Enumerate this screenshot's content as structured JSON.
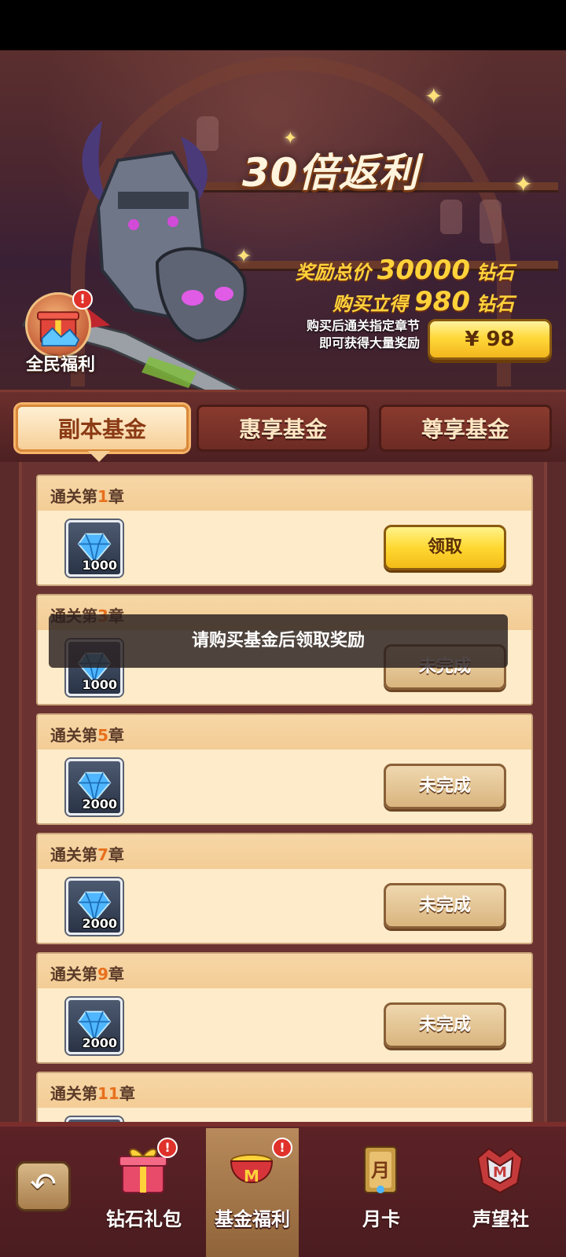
{
  "banner": {
    "headline": "30倍返利",
    "line1": {
      "prefix": "奖励总价",
      "value": "30000",
      "suffix": "钻石"
    },
    "line2": {
      "prefix": "购买立得",
      "value": "980",
      "suffix": "钻石"
    },
    "note_line1": "购买后通关指定章节",
    "note_line2": "即可获得大量奖励",
    "price_label": "¥ 98",
    "welfare_label": "全民福利",
    "welfare_badge": "!"
  },
  "tabs": [
    {
      "label": "副本基金",
      "active": true
    },
    {
      "label": "惠享基金",
      "active": false
    },
    {
      "label": "尊享基金",
      "active": false
    }
  ],
  "rewards": [
    {
      "prefix": "通关第",
      "chapter": "1",
      "suffix": "章",
      "qty": "1000",
      "button": "领取",
      "state": "claim"
    },
    {
      "prefix": "通关第",
      "chapter": "3",
      "suffix": "章",
      "qty": "1000",
      "button": "未完成",
      "state": "locked"
    },
    {
      "prefix": "通关第",
      "chapter": "5",
      "suffix": "章",
      "qty": "2000",
      "button": "未完成",
      "state": "locked"
    },
    {
      "prefix": "通关第",
      "chapter": "7",
      "suffix": "章",
      "qty": "2000",
      "button": "未完成",
      "state": "locked"
    },
    {
      "prefix": "通关第",
      "chapter": "9",
      "suffix": "章",
      "qty": "2000",
      "button": "未完成",
      "state": "locked"
    },
    {
      "prefix": "通关第",
      "chapter": "11",
      "suffix": "章",
      "qty": "",
      "button": "",
      "state": "locked"
    }
  ],
  "toast": "请购买基金后领取奖励",
  "bottom_nav": {
    "back_icon": "back-arrow-icon",
    "items": [
      {
        "label": "钻石礼包",
        "badge": "!",
        "icon": "gift-icon",
        "active": false
      },
      {
        "label": "基金福利",
        "badge": "!",
        "icon": "fund-pot-icon",
        "active": true
      },
      {
        "label": "月卡",
        "badge": "",
        "icon": "month-card-icon",
        "active": false
      },
      {
        "label": "声望社",
        "badge": "",
        "icon": "reputation-crest-icon",
        "active": false
      }
    ],
    "month_card_glyph": "月"
  },
  "colors": {
    "accent_gold": "#ffd83a",
    "chapter_number": "#e8701c",
    "card_bg": "#fdebc9",
    "badge_red": "#e0312a"
  }
}
